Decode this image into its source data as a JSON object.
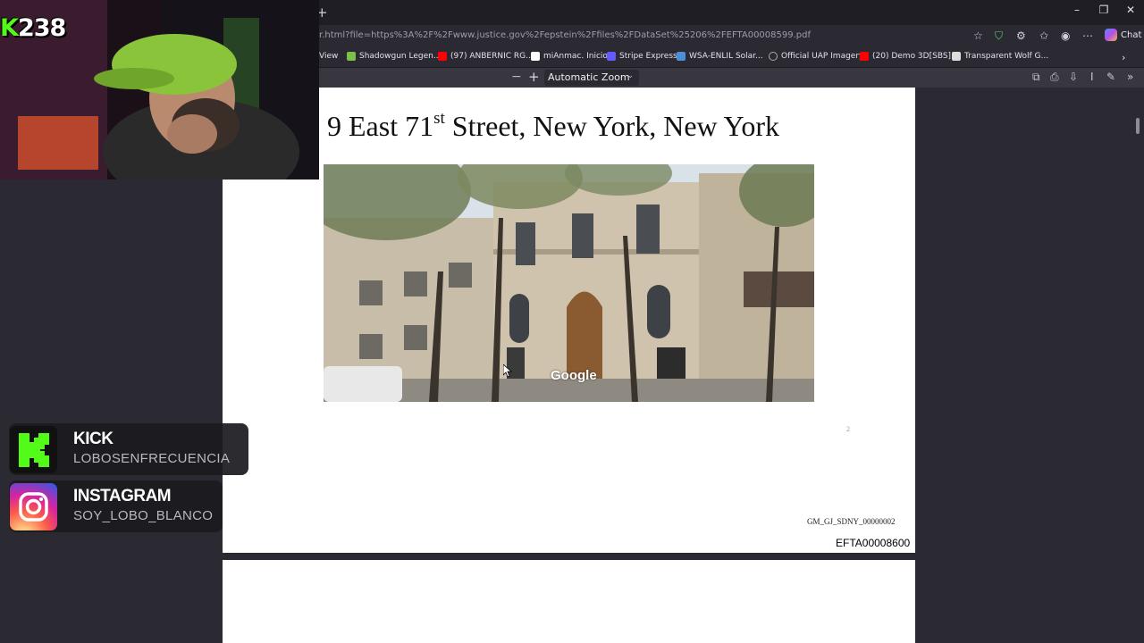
{
  "browser": {
    "url": "r.html?file=https%3A%2F%2Fwww.justice.gov%2Fepstein%2Ffiles%2FDataSet%25206%2FEFTA00008599.pdf",
    "chat_label": "Chat",
    "window_controls": [
      "–",
      "❐",
      "✕"
    ],
    "bookmarks": [
      {
        "label": "View",
        "color": "#888888"
      },
      {
        "label": "Shadowgun Legen...",
        "color": "#7cc04b"
      },
      {
        "label": "(97) ANBERNIC RG...",
        "color": "#ff0000"
      },
      {
        "label": "miAnmac. Inicio",
        "color": "#ffffff"
      },
      {
        "label": "Stripe Express",
        "color": "#635bff"
      },
      {
        "label": "WSA-ENLIL Solar...",
        "color": "#4a90d9"
      },
      {
        "label": "Official UAP Imagery",
        "color": "#888888"
      },
      {
        "label": "(20) Demo 3D[SBS]...",
        "color": "#ff0000"
      },
      {
        "label": "Transparent Wolf G...",
        "color": "#dddddd"
      }
    ]
  },
  "pdf_toolbar": {
    "zoom_label": "Automatic Zoom"
  },
  "document": {
    "title_main": "9 East 71",
    "title_sup": "st",
    "title_rest": " Street, New York, New York",
    "photo_watermark": "Google",
    "page_number": "2",
    "doc_id": "GM_GJ_SDNY_00000002",
    "bates": "EFTA00008600"
  },
  "overlay": {
    "viewer_count": "238",
    "kick_prefix": "K",
    "socials": [
      {
        "name": "KICK",
        "handle": "LOBOSENFRECUENCIA"
      },
      {
        "name": "INSTAGRAM",
        "handle": "SOY_LOBO_BLANCO"
      }
    ]
  },
  "colors": {
    "kick_green": "#53fc18",
    "browser_bg": "#2b2a33"
  }
}
